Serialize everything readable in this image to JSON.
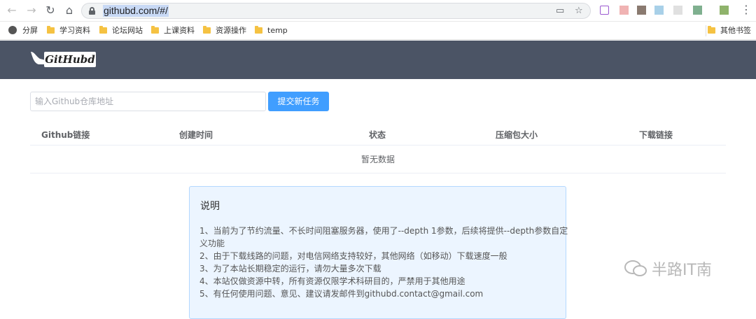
{
  "browser": {
    "url": "githubd.com/#/",
    "bookmarks": [
      "分屏",
      "学习资料",
      "论坛网站",
      "上课资料",
      "资源操作",
      "temp"
    ],
    "other_bookmarks": "其他书签"
  },
  "header": {
    "logo_text": "GitHubd"
  },
  "form": {
    "placeholder": "输入Github仓库地址",
    "submit_label": "提交新任务"
  },
  "table": {
    "columns": [
      "Github链接",
      "创建时间",
      "状态",
      "压缩包大小",
      "下载链接"
    ],
    "empty_text": "暂无数据"
  },
  "notice": {
    "title": "说明",
    "lines": [
      "1、当前为了节约流量、不长时间阻塞服务器，使用了--depth 1参数，后续将提供--depth参数自定",
      "义功能",
      "2、由于下载线路的问题，对电信网络支持较好，其他网络（如移动）下载速度一般",
      "3、为了本站长期稳定的运行，请勿大量多次下载",
      "4、本站仅做资源中转，所有资源仅限学术科研目的，严禁用于其他用途",
      "5、有任何使用问题、意见、建议请发邮件到githubd.contact@gmail.com"
    ]
  },
  "watermark": {
    "text": "半路IT南"
  }
}
